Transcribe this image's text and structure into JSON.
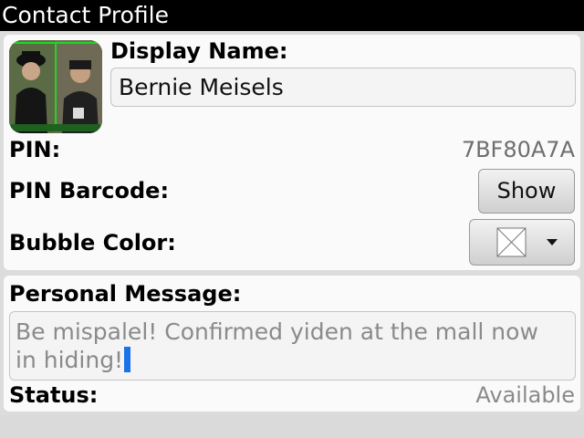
{
  "header": {
    "title": "Contact Profile"
  },
  "profile": {
    "display_name_label": "Display Name:",
    "display_name_value": "Bernie Meisels",
    "pin_label": "PIN:",
    "pin_value": "7BF80A7A",
    "pin_barcode_label": "PIN Barcode:",
    "show_button_label": "Show",
    "bubble_color_label": "Bubble Color:"
  },
  "message": {
    "personal_message_label": "Personal Message:",
    "personal_message_value": "Be mispalel! Confirmed yiden at the mall now in hiding!",
    "status_label": "Status:",
    "status_value": "Available"
  },
  "colors": {
    "title_bar": "#000000",
    "panel": "#fafafa",
    "cursor": "#1a73e8"
  },
  "icons": {
    "dropdown": "triangle-down",
    "color_swatch": "empty-swatch"
  }
}
